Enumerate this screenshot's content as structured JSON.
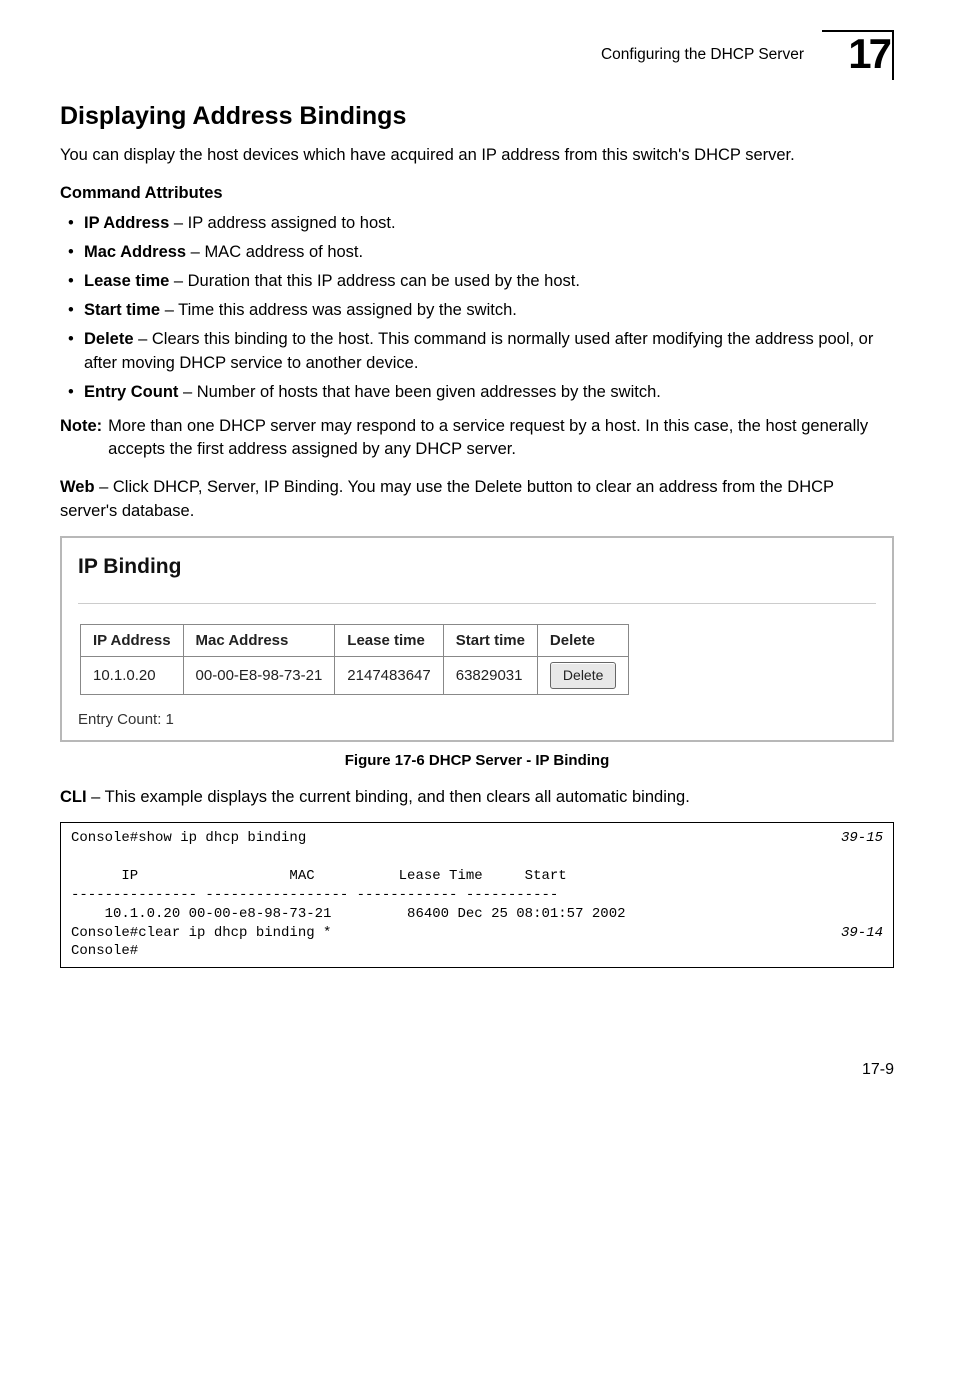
{
  "header": {
    "breadcrumb": "Configuring the DHCP Server",
    "badge_number": "17"
  },
  "section_title": "Displaying Address Bindings",
  "intro": "You can display the host devices which have acquired an IP address from this switch's DHCP server.",
  "cmd_attr_heading": "Command Attributes",
  "bullets": [
    {
      "term": "IP Address",
      "desc": " – IP address assigned to host."
    },
    {
      "term": "Mac Address",
      "desc": " – MAC address of host."
    },
    {
      "term": "Lease time",
      "desc": " – Duration that this IP address can be used by the host."
    },
    {
      "term": "Start time",
      "desc": " – Time this address was assigned by the switch."
    },
    {
      "term": "Delete",
      "desc": " – Clears this binding to the host. This command is normally used after modifying the address pool, or after moving DHCP service to another device."
    },
    {
      "term": "Entry Count",
      "desc": " – Number of hosts that have been given addresses by the switch."
    }
  ],
  "note": {
    "label": "Note:",
    "body": "More than one DHCP server may respond to a service request by a host. In this case, the host generally accepts the first address assigned by any DHCP server."
  },
  "web_lead": "Web",
  "web_text": " – Click DHCP, Server, IP Binding. You may use the Delete button to clear an address from the DHCP server's database.",
  "figure": {
    "title": "IP Binding",
    "headers": [
      "IP Address",
      "Mac Address",
      "Lease time",
      "Start time",
      "Delete"
    ],
    "row": {
      "ip": "10.1.0.20",
      "mac": "00-00-E8-98-73-21",
      "lease": "2147483647",
      "start": "63829031",
      "delete_label": "Delete"
    },
    "entry_count": "Entry Count: 1",
    "caption": "Figure 17-6   DHCP Server - IP Binding"
  },
  "cli_lead": "CLI",
  "cli_text": " – This example displays the current binding, and then clears all automatic binding.",
  "cli_block": {
    "line1": "Console#show ip dhcp binding",
    "ref1": "39-15",
    "line2": "      IP                  MAC          Lease Time     Start",
    "line3": "--------------- ----------------- ------------ -----------",
    "line4": "    10.1.0.20 00-00-e8-98-73-21         86400 Dec 25 08:01:57 2002",
    "line5": "Console#clear ip dhcp binding *",
    "ref2": "39-14",
    "line6": "Console#"
  },
  "footer_page": "17-9"
}
